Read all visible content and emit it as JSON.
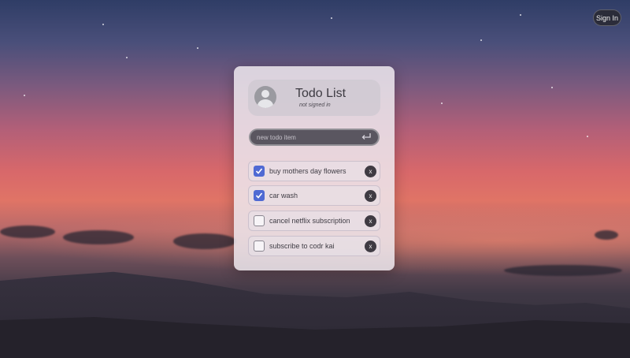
{
  "header": {
    "signin_label": "Sign In"
  },
  "card": {
    "title": "Todo List",
    "subtitle": "not signed in",
    "new_item": {
      "placeholder": "new todo item",
      "value": ""
    },
    "items": [
      {
        "label": "buy mothers day flowers",
        "checked": true,
        "delete_label": "x"
      },
      {
        "label": "car wash",
        "checked": true,
        "delete_label": "x"
      },
      {
        "label": "cancel netflix subscription",
        "checked": false,
        "delete_label": "x"
      },
      {
        "label": "subscribe to codr kai",
        "checked": false,
        "delete_label": "x"
      }
    ]
  },
  "icons": {
    "avatar": "user-avatar-icon",
    "enter": "enter-return-icon",
    "check": "checkmark-icon",
    "delete": "close-icon"
  },
  "colors": {
    "accent": "#4f6ad3",
    "card": "#eee8ee",
    "input": "#5a5660",
    "delete": "#3f3b43"
  }
}
